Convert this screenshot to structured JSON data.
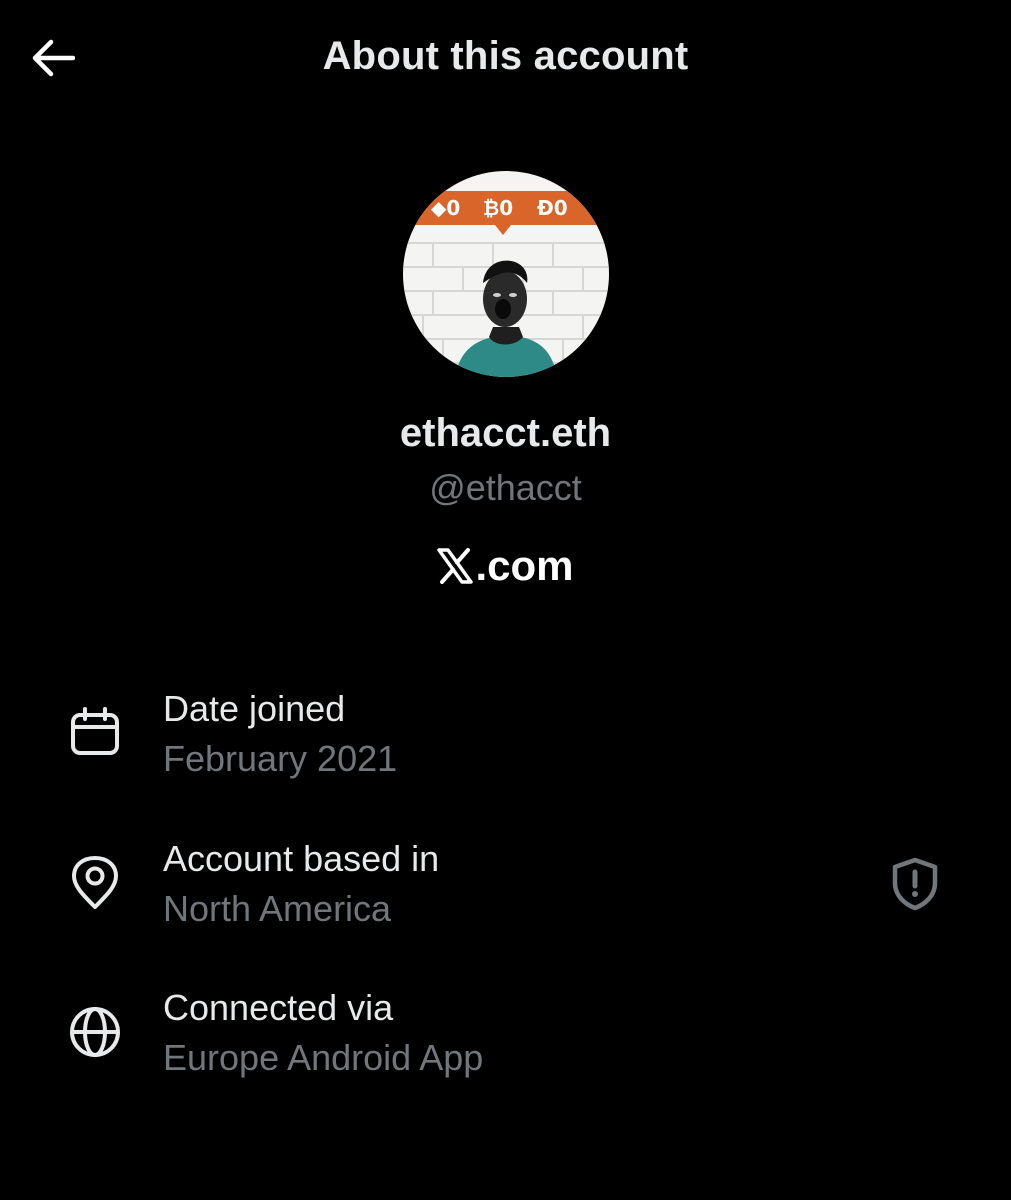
{
  "header": {
    "title": "About this account",
    "back_icon": "arrow-left-icon"
  },
  "profile": {
    "display_name": "ethacct.eth",
    "handle": "@ethacct",
    "avatar": {
      "banner_color": "#d9652b",
      "banner_text": [
        "◆0",
        "₿0",
        "Đ0"
      ],
      "shirt_color": "#2e8a86"
    },
    "brand_suffix": ".com",
    "brand_icon": "x-logo-icon"
  },
  "details": [
    {
      "icon": "calendar-icon",
      "label": "Date joined",
      "value": "February 2021"
    },
    {
      "icon": "location-pin-icon",
      "label": "Account based in",
      "value": "North America",
      "badge_icon": "shield-alert-icon"
    },
    {
      "icon": "globe-icon",
      "label": "Connected via",
      "value": "Europe Android App"
    }
  ],
  "colors": {
    "background": "#000000",
    "primary_text": "#e7e9ea",
    "secondary_text": "#71767b"
  }
}
